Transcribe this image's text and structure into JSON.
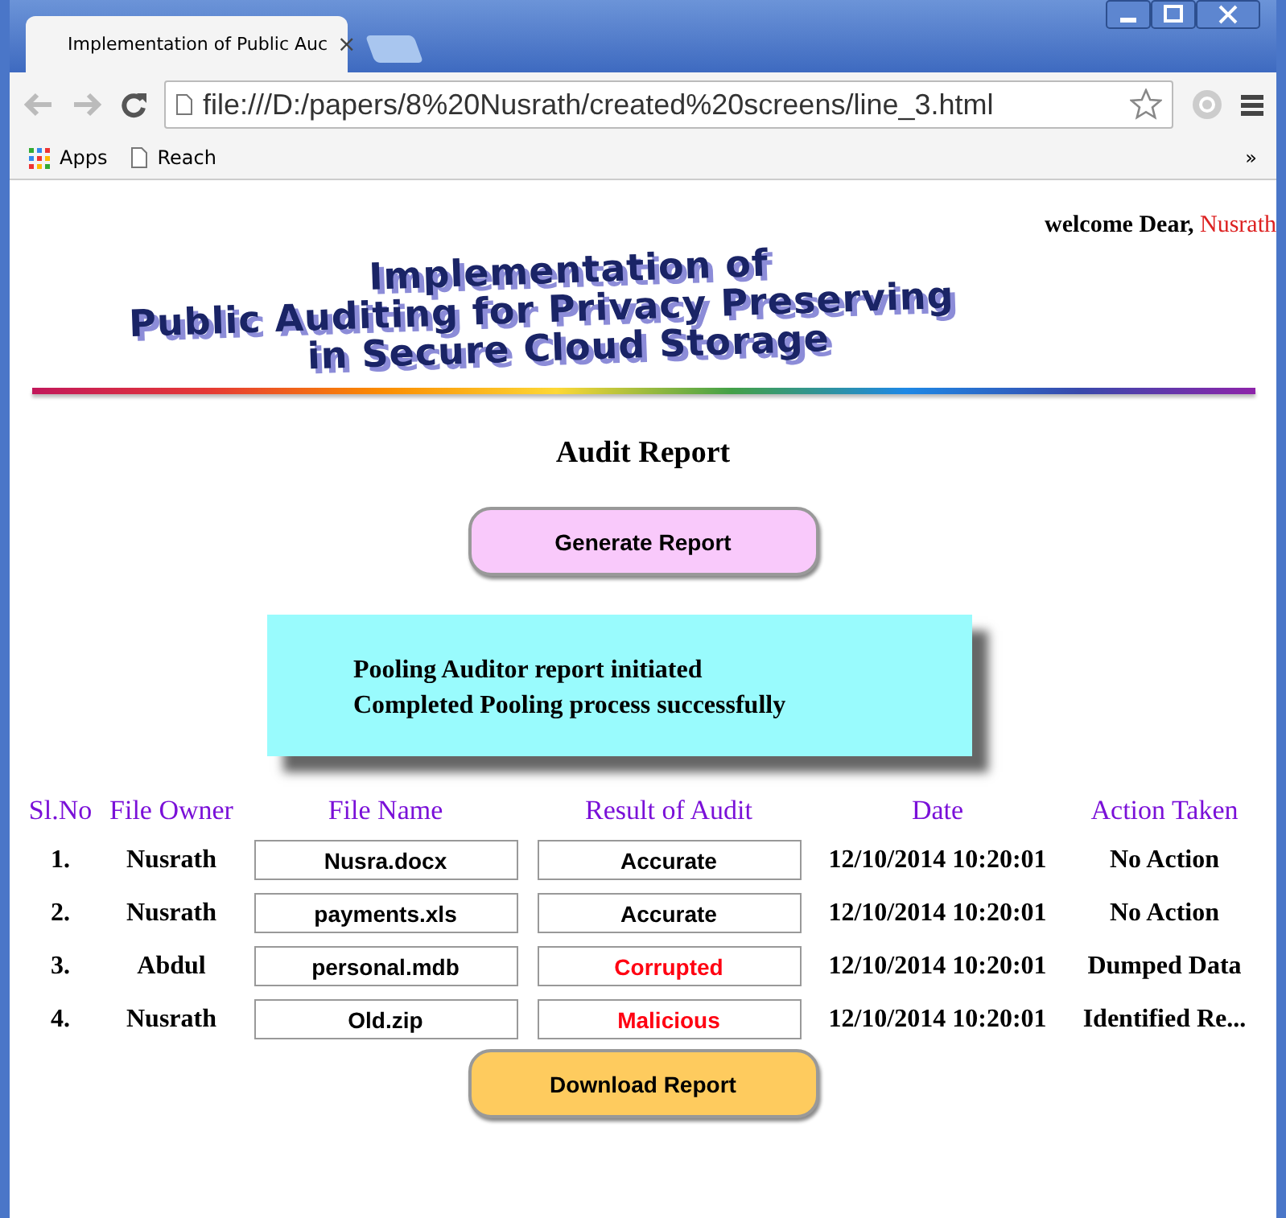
{
  "browser": {
    "tab_title": "Implementation of Public Auc",
    "tab_close": "×",
    "url": "file:///D:/papers/8%20Nusrath/created%20screens/line_3.html",
    "bookmarks": [
      "Apps",
      "Reach"
    ],
    "overflow": "»"
  },
  "welcome": {
    "text": "welcome Dear,",
    "user": "Nusrath"
  },
  "banner": [
    "Implementation of",
    "Public Auditing for Privacy Preserving",
    "in Secure Cloud Storage"
  ],
  "heading": "Audit Report",
  "generate_button": "Generate Report",
  "messages": [
    "Pooling Auditor report initiated",
    "Completed Pooling process successfully"
  ],
  "table": {
    "columns": [
      "Sl.No",
      "File Owner",
      "File Name",
      "Result of Audit",
      "Date",
      "Action Taken"
    ],
    "rows": [
      {
        "no": "1.",
        "owner": "Nusrath",
        "file": "Nusra.docx",
        "result": "Accurate",
        "flagged": false,
        "date": "12/10/2014 10:20:01",
        "action": "No Action"
      },
      {
        "no": "2.",
        "owner": "Nusrath",
        "file": "payments.xls",
        "result": "Accurate",
        "flagged": false,
        "date": "12/10/2014 10:20:01",
        "action": "No Action"
      },
      {
        "no": "3.",
        "owner": "Abdul",
        "file": "personal.mdb",
        "result": "Corrupted",
        "flagged": true,
        "date": "12/10/2014 10:20:01",
        "action": "Dumped Data"
      },
      {
        "no": "4.",
        "owner": "Nusrath",
        "file": "Old.zip",
        "result": "Malicious",
        "flagged": true,
        "date": "12/10/2014 10:20:01",
        "action": "Identified Re..."
      }
    ]
  },
  "download_button": "Download Report"
}
